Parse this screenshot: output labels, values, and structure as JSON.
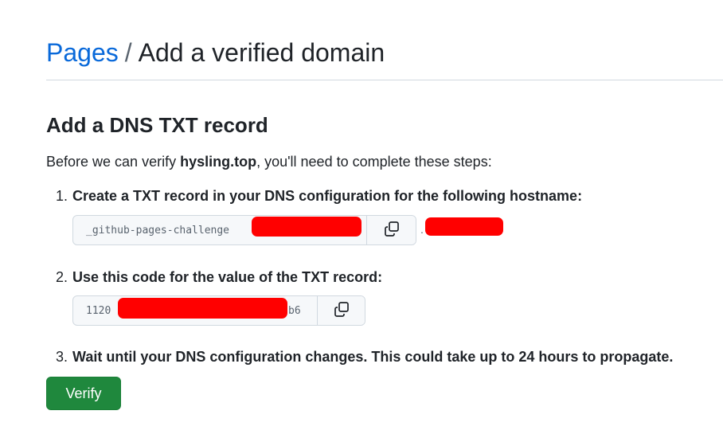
{
  "breadcrumb": {
    "parent": "Pages",
    "separator": "/",
    "current": "Add a verified domain"
  },
  "section": {
    "title": "Add a DNS TXT record",
    "intro_prefix": "Before we can verify ",
    "domain": "hysling.top",
    "intro_suffix": ", you'll need to complete these steps:"
  },
  "steps": [
    {
      "number": "1.",
      "text": "Create a TXT record in your DNS configuration for the following hostname:"
    },
    {
      "number": "2.",
      "text": "Use this code for the value of the TXT record:"
    },
    {
      "number": "3.",
      "text": "Wait until your DNS configuration changes. This could take up to 24 hours to propagate."
    }
  ],
  "hostname_box": {
    "visible_text": "_github-pages-challenge",
    "suffix_separator": "."
  },
  "code_box": {
    "visible_prefix": "1120",
    "visible_suffix": "b6"
  },
  "icons": {
    "copy": "copy-icon"
  },
  "verify_button": {
    "label": "Verify"
  },
  "colors": {
    "link": "#0969da",
    "primary_button": "#1f883d",
    "redaction": "#ff0000"
  }
}
